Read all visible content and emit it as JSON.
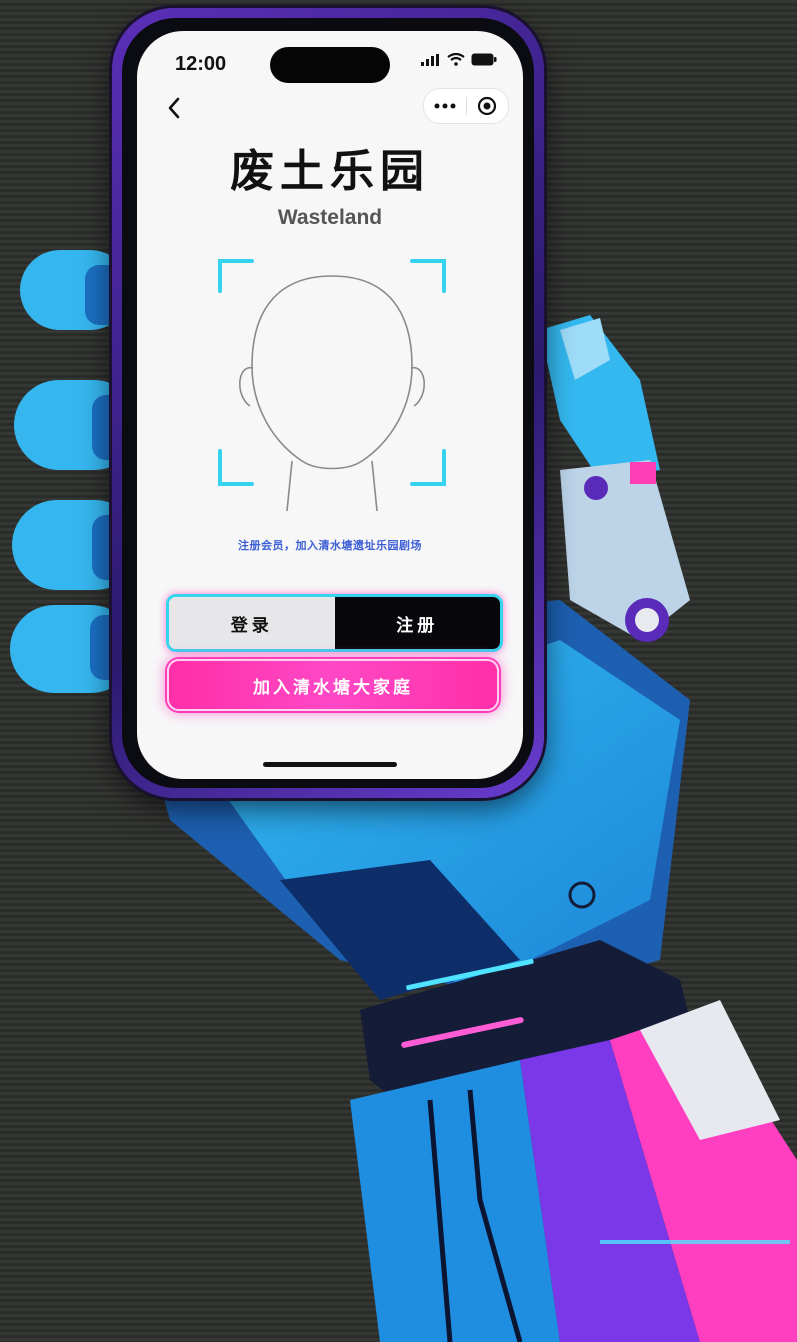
{
  "status_bar": {
    "time": "12:00"
  },
  "nav": {
    "back_icon": "chevron-left-icon",
    "more_icon": "more-dots-icon",
    "close_icon": "target-circle-icon"
  },
  "header": {
    "title": "废土乐园",
    "subtitle": "Wasteland"
  },
  "face_scan": {
    "icon": "face-outline-icon"
  },
  "hint_text": "注册会员，加入清水塘遗址乐园剧场",
  "auth_toggle": {
    "login_label": "登录",
    "register_label": "注册",
    "selected": "注册"
  },
  "join_button": {
    "label": "加入清水塘大家庭"
  },
  "colors": {
    "accent_cyan": "#35d5ee",
    "accent_pink": "#ff2fa8",
    "accent_purple": "#6a3cd0",
    "hint_blue": "#3d5fd6",
    "robot_blue": "#29a8f0"
  }
}
